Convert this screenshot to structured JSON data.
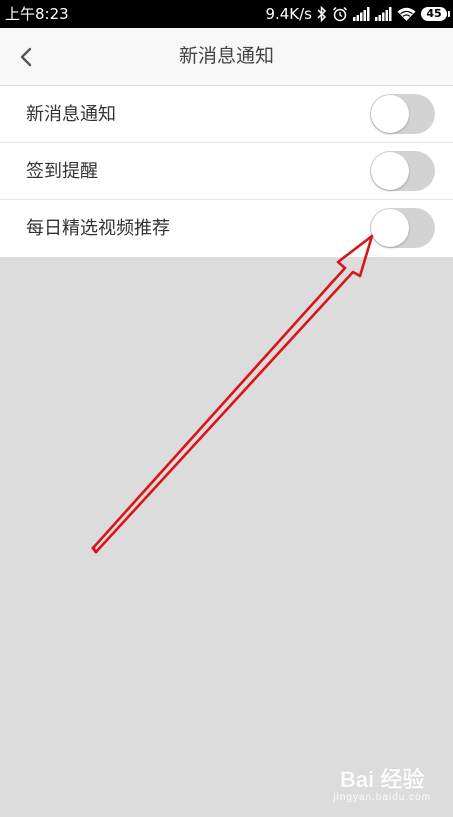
{
  "status_bar": {
    "time": "上午8:23",
    "net_speed": "9.4K/s",
    "battery": "45",
    "icons": [
      "bluetooth-icon",
      "alarm-icon",
      "signal-icon",
      "signal-icon",
      "wifi-icon",
      "battery-icon"
    ]
  },
  "header": {
    "back_icon": "chevron-left-icon",
    "title": "新消息通知"
  },
  "settings": [
    {
      "label": "新消息通知",
      "enabled": false
    },
    {
      "label": "签到提醒",
      "enabled": false
    },
    {
      "label": "每日精选视频推荐",
      "enabled": false
    }
  ],
  "watermark": {
    "brand": "Bai 经验",
    "url": "jingyan.baidu.com"
  },
  "colors": {
    "status_bar_bg": "#000000",
    "header_bg": "#f8f8f8",
    "list_bg": "#ffffff",
    "page_bg": "#dcdcdc",
    "toggle_off": "#d3d3d3",
    "annotation_arrow": "#d9141b"
  }
}
